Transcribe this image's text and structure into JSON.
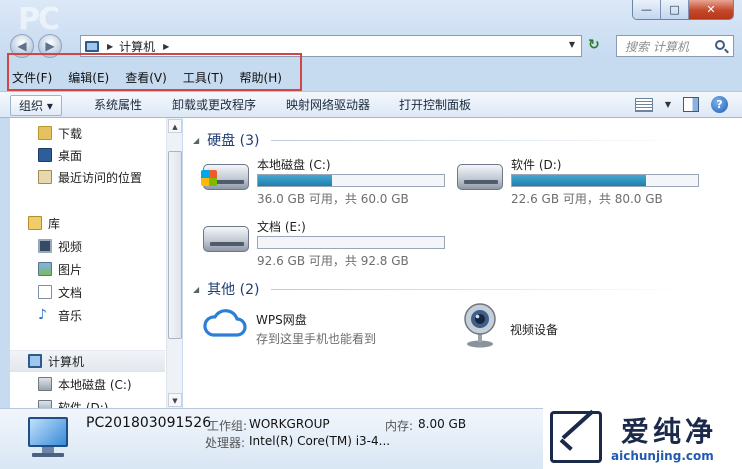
{
  "window": {
    "controls": {
      "minimize": "—",
      "maximize": "□",
      "close": "✕"
    }
  },
  "address_bar": {
    "path": "计算机",
    "search_placeholder": "搜索 计算机"
  },
  "menu": [
    "文件(F)",
    "编辑(E)",
    "查看(V)",
    "工具(T)",
    "帮助(H)"
  ],
  "toolbar": {
    "organize": "组织 ▾",
    "items": [
      "系统属性",
      "卸载或更改程序",
      "映射网络驱动器",
      "打开控制面板"
    ]
  },
  "nav_pane": {
    "favorites": [
      "下载",
      "桌面",
      "最近访问的位置"
    ],
    "library_header": "库",
    "libraries": [
      "视频",
      "图片",
      "文档",
      "音乐"
    ],
    "computer": "计算机",
    "drives": [
      "本地磁盘 (C:)",
      "软件 (D:)"
    ]
  },
  "sections": {
    "hard_disks": "硬盘 (3)",
    "other": "其他 (2)"
  },
  "drives": [
    {
      "name": "本地磁盘 (C:)",
      "usage": "36.0 GB 可用，共 60.0 GB",
      "used_fraction": 0.4
    },
    {
      "name": "软件 (D:)",
      "usage": "22.6 GB 可用，共 80.0 GB",
      "used_fraction": 0.72
    },
    {
      "name": "文档 (E:)",
      "usage": "92.6 GB 可用，共 92.8 GB",
      "used_fraction": 0.0
    }
  ],
  "other_items": {
    "wps_name": "WPS网盘",
    "wps_sub": "存到这里手机也能看到",
    "camera_name": "视频设备"
  },
  "details": {
    "computer_name": "PC201803091526",
    "workgroup_label": "工作组:",
    "workgroup_value": "WORKGROUP",
    "memory_label": "内存:",
    "memory_value": "8.00 GB",
    "processor_label": "处理器:",
    "processor_value": "Intel(R) Core(TM) i3-4..."
  },
  "watermark": {
    "name": "爱纯净",
    "url": "aichunjing.com",
    "logo_text": "PC"
  },
  "colors": {
    "highlight_box": "#d04545",
    "bar_fill": "#1c7fae",
    "section_heading": "#1f3f73"
  }
}
